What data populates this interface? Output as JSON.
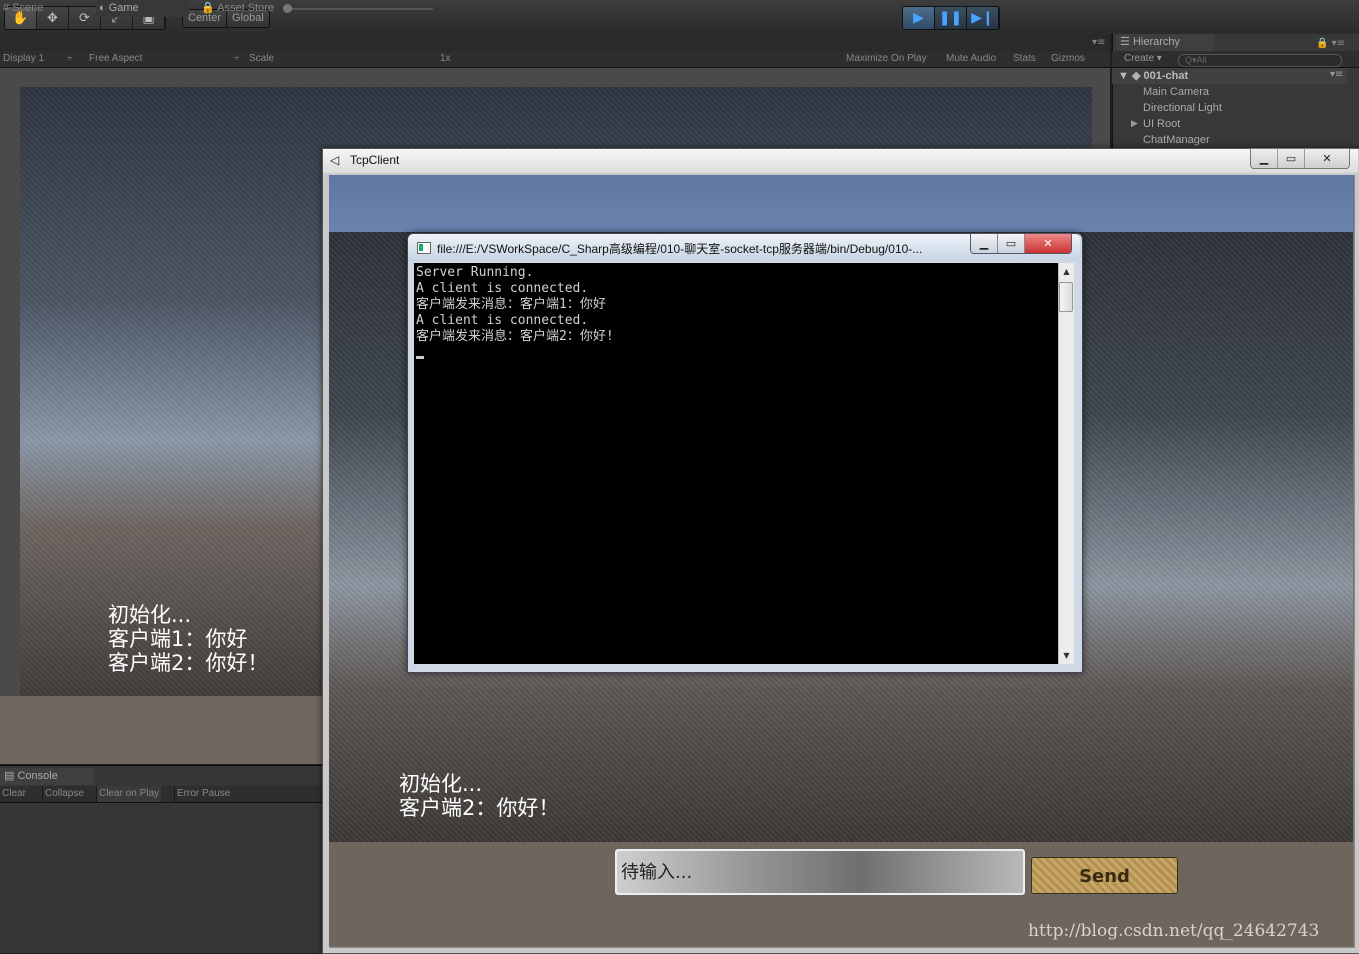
{
  "toolbar": {
    "tools": [
      "hand-tool",
      "move-tool",
      "rotate-tool",
      "scale-tool",
      "rect-tool"
    ],
    "pivot": "Center",
    "space": "Global"
  },
  "tabs": {
    "scene": "Scene",
    "game": "Game",
    "asset_store": "Asset Store"
  },
  "game_bar": {
    "display": "Display 1",
    "aspect": "Free Aspect",
    "scale_label": "Scale",
    "scale_value": "1x",
    "maximize": "Maximize On Play",
    "mute": "Mute Audio",
    "stats": "Stats",
    "gizmos": "Gizmos"
  },
  "game_chat_log": [
    "初始化...",
    "客户端1：你好",
    "客户端2：你好！"
  ],
  "hierarchy": {
    "title": "Hierarchy",
    "create": "Create",
    "search_placeholder": "All",
    "root": "001-chat",
    "items": [
      "Main Camera",
      "Directional Light",
      "UI Root",
      "ChatManager"
    ]
  },
  "console": {
    "title": "Console",
    "clear": "Clear",
    "collapse": "Collapse",
    "clear_on_play": "Clear on Play",
    "error_pause": "Error Pause"
  },
  "tcp_window": {
    "title": "TcpClient",
    "chat_log": [
      "初始化...",
      "客户端2：你好！"
    ],
    "input_placeholder": "待输入...",
    "send_label": "Send"
  },
  "cmd_window": {
    "title": "file:///E:/VSWorkSpace/C_Sharp高级编程/010-聊天室-socket-tcp服务器端/bin/Debug/010-...",
    "lines": [
      "Server Running.",
      "A client is connected.",
      "客户端发来消息：客户端1：你好",
      "A client is connected.",
      "客户端发来消息：客户端2：你好!"
    ]
  },
  "watermark": "http://blog.csdn.net/qq_24642743"
}
